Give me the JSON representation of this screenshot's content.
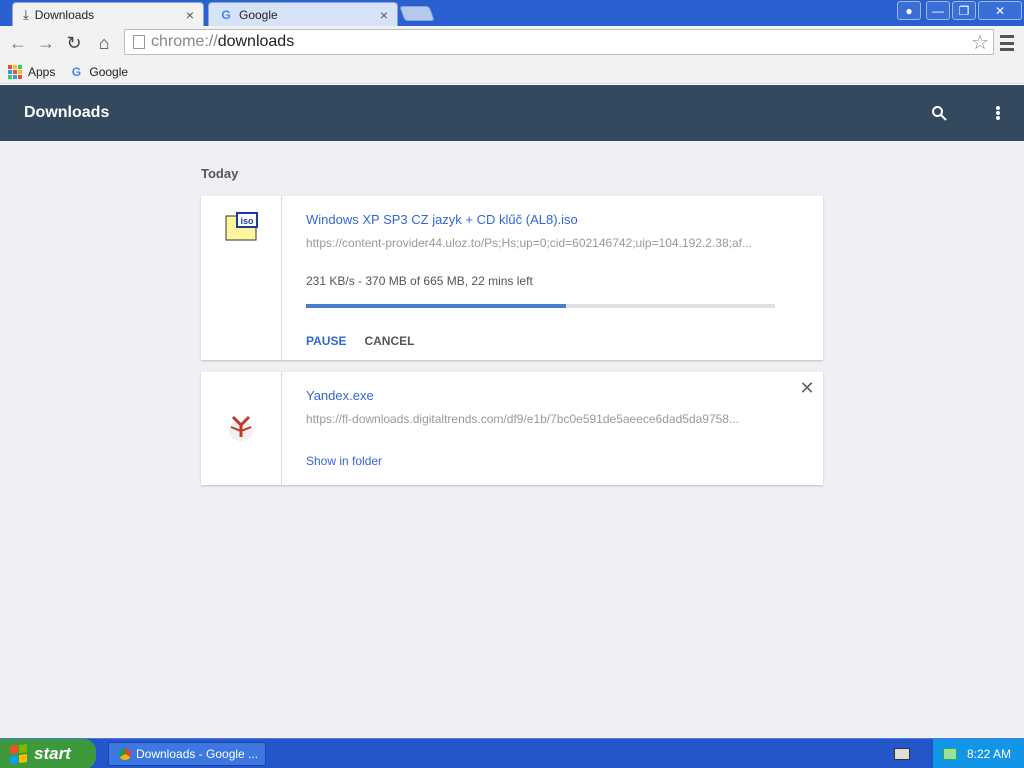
{
  "browser": {
    "tabs": [
      {
        "label": "Downloads",
        "icon": "download-icon",
        "active": true
      },
      {
        "label": "Google",
        "icon": "google-icon",
        "active": false
      }
    ],
    "window_controls": [
      "user",
      "minimize",
      "restore",
      "close"
    ],
    "omnibox": {
      "scheme": "chrome://",
      "path": "downloads"
    },
    "bookmarks": [
      {
        "label": "Apps",
        "icon": "apps-grid-icon"
      },
      {
        "label": "Google",
        "icon": "google-icon"
      }
    ]
  },
  "header": {
    "title": "Downloads"
  },
  "section": {
    "today": "Today"
  },
  "downloads": [
    {
      "name": "Windows XP SP3 CZ jazyk + CD klűč (AL8).iso",
      "url": "https://content-provider44.uloz.to/Ps;Hs;up=0;cid=602146742;uip=104.192.2.38;af...",
      "status": "231 KB/s - 370 MB of 665 MB, 22 mins left",
      "progress_fraction": 0.555,
      "actions": {
        "pause": "PAUSE",
        "cancel": "CANCEL"
      },
      "icon": "iso-file-icon"
    },
    {
      "name": "Yandex.exe",
      "url": "https://fl-downloads.digitaltrends.com/df9/e1b/7bc0e591de5aeece6dad5da9758...",
      "link": "Show in folder",
      "icon": "yandex-icon"
    }
  ],
  "taskbar": {
    "start": "start",
    "task": "Downloads - Google ...",
    "clock": "8:22 AM"
  },
  "colors": {
    "header_bg": "#34485e",
    "page_bg": "#eef0f3",
    "link_blue": "#3367d6",
    "progress_fill": "#4a7ccc"
  }
}
